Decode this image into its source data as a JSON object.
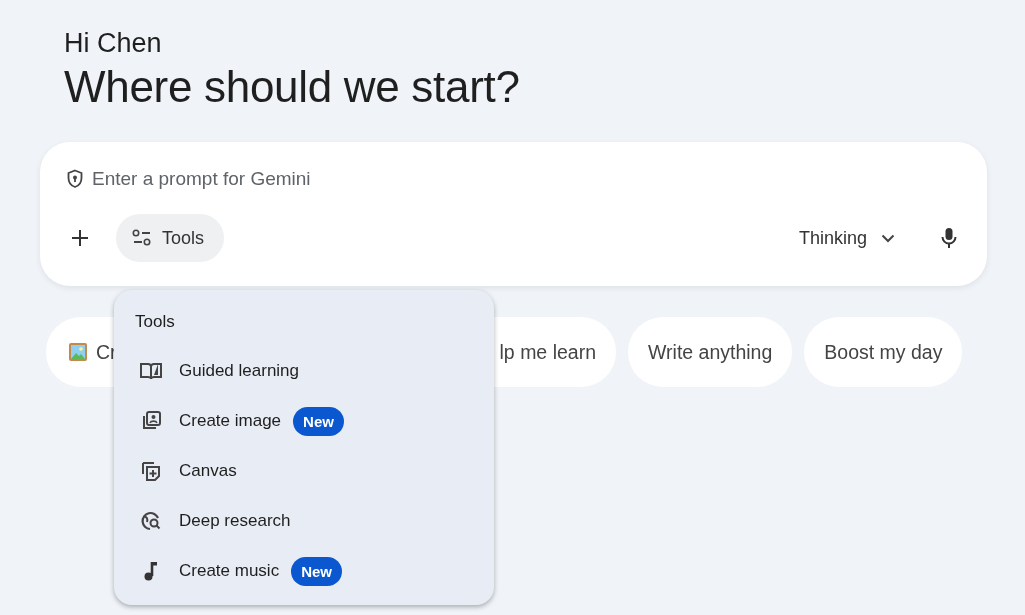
{
  "greeting": "Hi Chen",
  "heading": "Where should we start?",
  "prompt": {
    "placeholder": "Enter a prompt for Gemini",
    "tools_button": "Tools",
    "mode": "Thinking"
  },
  "chips": [
    {
      "label": "Cr"
    },
    {
      "label": "lp me learn"
    },
    {
      "label": "Write anything"
    },
    {
      "label": "Boost my day"
    }
  ],
  "tools_menu": {
    "title": "Tools",
    "items": [
      {
        "label": "Guided learning"
      },
      {
        "label": "Create image",
        "badge": "New"
      },
      {
        "label": "Canvas"
      },
      {
        "label": "Deep research"
      },
      {
        "label": "Create music",
        "badge": "New"
      }
    ]
  }
}
